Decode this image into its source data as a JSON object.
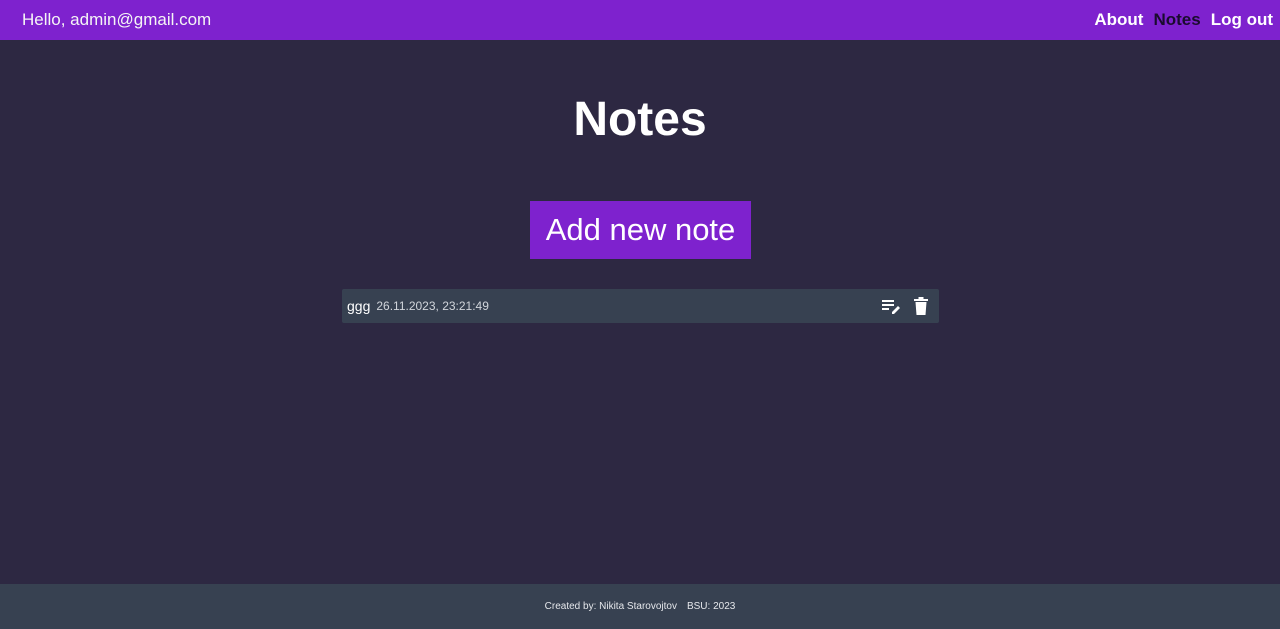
{
  "header": {
    "greeting": "Hello, admin@gmail.com",
    "nav": {
      "about": "About",
      "notes": "Notes",
      "logout": "Log out"
    }
  },
  "main": {
    "title": "Notes",
    "add_button_label": "Add new note",
    "notes": [
      {
        "title": "ggg",
        "date": "26.11.2023, 23:21:49",
        "actions": [
          "edit-icon",
          "trash-icon"
        ]
      }
    ]
  },
  "footer": {
    "created_by": "Created by: Nikita Starovojtov",
    "org": "BSU: 2023"
  },
  "colors": {
    "accent": "#7e22ce",
    "background": "#2d2842",
    "panel": "#374151",
    "active_nav": "#1a0b2e"
  }
}
